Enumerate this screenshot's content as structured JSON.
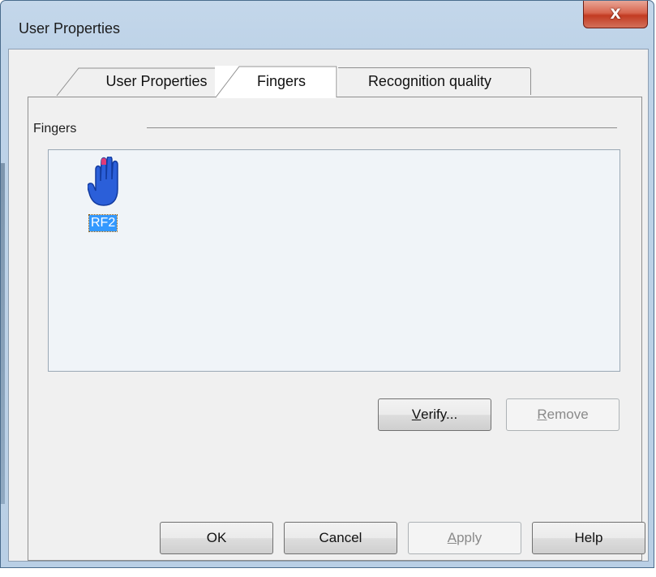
{
  "window": {
    "title": "User Properties",
    "close_glyph": "X"
  },
  "tabs": [
    {
      "label": "User Properties",
      "active": false
    },
    {
      "label": "Fingers",
      "active": true
    },
    {
      "label": "Recognition quality",
      "active": false
    }
  ],
  "fingers_page": {
    "group_label": "Fingers",
    "items": [
      {
        "label": "RF2",
        "icon": "hand-icon",
        "selected": true
      }
    ],
    "verify_button": {
      "accel": "V",
      "rest": "erify...",
      "enabled": true
    },
    "remove_button": {
      "accel": "R",
      "rest": "emove",
      "enabled": false
    }
  },
  "footer": {
    "ok": "OK",
    "cancel": "Cancel",
    "apply": {
      "accel": "A",
      "rest": "pply",
      "enabled": false
    },
    "help": "Help"
  },
  "colors": {
    "frame": "#bed3e8",
    "close": "#c94f3a",
    "selection": "#3399ff",
    "hand": "#2b5fd9"
  }
}
